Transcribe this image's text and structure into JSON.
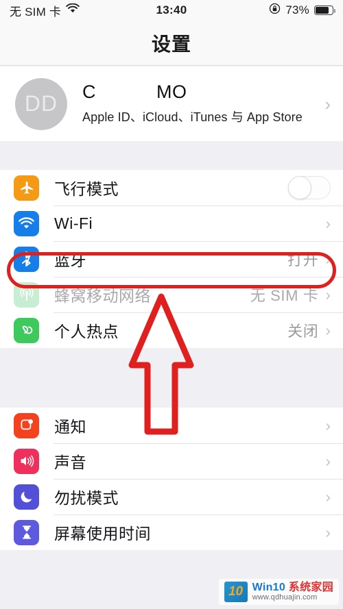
{
  "status_bar": {
    "carrier": "无 SIM 卡",
    "wifi_icon": "wifi-icon",
    "time": "13:40",
    "rotation_lock_icon": "rotation-lock-icon",
    "battery_percent": "73%",
    "battery_level": 73,
    "battery_icon": "battery-icon"
  },
  "nav": {
    "title": "设置"
  },
  "account": {
    "avatar_initials": "DD",
    "name": "C           MO",
    "subtitle": "Apple ID、iCloud、iTunes 与 App Store",
    "chevron": "›"
  },
  "groups": [
    {
      "rows": [
        {
          "icon": "airplane-icon",
          "icon_color": "#f59a14",
          "label": "飞行模式",
          "control": "toggle",
          "toggle_on": false,
          "dim": false
        },
        {
          "icon": "wifi-icon",
          "icon_color": "#157ee8",
          "label": "Wi-Fi",
          "value": "",
          "control": "chevron",
          "chevron": "›",
          "dim": false
        },
        {
          "icon": "bluetooth-icon",
          "icon_color": "#157ee8",
          "label": "蓝牙",
          "value": "打开",
          "control": "chevron",
          "chevron": "›",
          "dim": false,
          "highlighted": true
        },
        {
          "icon": "cellular-icon",
          "icon_color": "#6fd48a",
          "label": "蜂窝移动网络",
          "value": "无 SIM 卡",
          "control": "chevron",
          "chevron": "›",
          "dim": true
        },
        {
          "icon": "hotspot-icon",
          "icon_color": "#3ec95c",
          "label": "个人热点",
          "value": "关闭",
          "control": "chevron",
          "chevron": "›",
          "dim": false
        }
      ]
    },
    {
      "rows": [
        {
          "icon": "notifications-icon",
          "icon_color": "#f43f２0",
          "label": "通知",
          "value": "",
          "control": "chevron",
          "chevron": "›",
          "dim": false
        },
        {
          "icon": "sounds-icon",
          "icon_color": "#ef2f5c",
          "label": "声音",
          "value": "",
          "control": "chevron",
          "chevron": "›",
          "dim": false
        },
        {
          "icon": "do-not-disturb-icon",
          "icon_color": "#5350d8",
          "label": "勿扰模式",
          "value": "",
          "control": "chevron",
          "chevron": "›",
          "dim": false
        },
        {
          "icon": "screen-time-icon",
          "icon_color": "#5d5ae0",
          "label": "屏幕使用时间",
          "value": "",
          "control": "chevron",
          "chevron": "›",
          "dim": false
        }
      ]
    }
  ],
  "annotations": {
    "highlight_color": "#e01f1f",
    "highlight_target": "蓝牙",
    "arrow_color": "#e01f1f",
    "arrow_direction": "up",
    "arrow_points_to": "蓝牙"
  },
  "watermark": {
    "logo_text": "10",
    "brand_prefix": "Win10",
    "brand_suffix": "系统家园",
    "url": "www.qdhuajin.com"
  }
}
